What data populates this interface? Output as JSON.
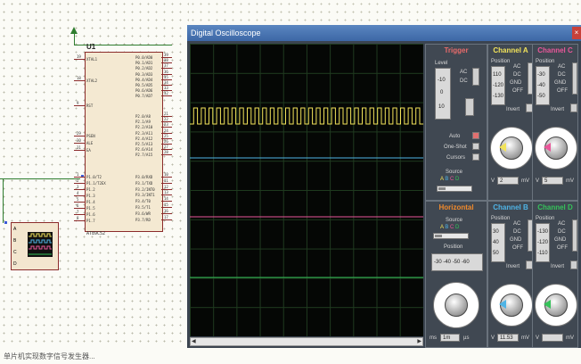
{
  "colors": {
    "channel_a": "#f2e35a",
    "channel_b": "#4fb4e6",
    "channel_c": "#e9579a",
    "channel_d": "#35c25a",
    "trigger": "#e86b6b",
    "horizontal": "#f08a2c"
  },
  "chip": {
    "name": "U1",
    "part": "AT89C52",
    "left_pins": [
      {
        "num": "19",
        "name": "XTAL1"
      },
      {
        "num": "18",
        "name": "XTAL2"
      },
      {
        "num": "9",
        "name": "RST"
      },
      {
        "num": "29",
        "name": "PSEN"
      },
      {
        "num": "30",
        "name": "ALE"
      },
      {
        "num": "31",
        "name": "EA"
      },
      {
        "num": "1",
        "name": "P1.0/T2"
      },
      {
        "num": "2",
        "name": "P1.1/T2EX"
      },
      {
        "num": "3",
        "name": "P1.2"
      },
      {
        "num": "4",
        "name": "P1.3"
      },
      {
        "num": "5",
        "name": "P1.4"
      },
      {
        "num": "6",
        "name": "P1.5"
      },
      {
        "num": "7",
        "name": "P1.6"
      },
      {
        "num": "8",
        "name": "P1.7"
      }
    ],
    "right_pins": [
      {
        "num": "39",
        "name": "P0.0/AD0"
      },
      {
        "num": "38",
        "name": "P0.1/AD1"
      },
      {
        "num": "37",
        "name": "P0.2/AD2"
      },
      {
        "num": "36",
        "name": "P0.3/AD3"
      },
      {
        "num": "35",
        "name": "P0.4/AD4"
      },
      {
        "num": "34",
        "name": "P0.5/AD5"
      },
      {
        "num": "33",
        "name": "P0.6/AD6"
      },
      {
        "num": "32",
        "name": "P0.7/AD7"
      },
      {
        "num": "21",
        "name": "P2.0/A8"
      },
      {
        "num": "22",
        "name": "P2.1/A9"
      },
      {
        "num": "23",
        "name": "P2.2/A10"
      },
      {
        "num": "24",
        "name": "P2.3/A11"
      },
      {
        "num": "25",
        "name": "P2.4/A12"
      },
      {
        "num": "26",
        "name": "P2.5/A13"
      },
      {
        "num": "27",
        "name": "P2.6/A14"
      },
      {
        "num": "28",
        "name": "P2.7/A15"
      },
      {
        "num": "10",
        "name": "P3.0/RXD"
      },
      {
        "num": "11",
        "name": "P3.1/TXD"
      },
      {
        "num": "12",
        "name": "P3.2/INT0"
      },
      {
        "num": "13",
        "name": "P3.3/INT1"
      },
      {
        "num": "14",
        "name": "P3.4/T0"
      },
      {
        "num": "15",
        "name": "P3.5/T1"
      },
      {
        "num": "16",
        "name": "P3.6/WR"
      },
      {
        "num": "17",
        "name": "P3.7/RD"
      }
    ]
  },
  "scope_symbol": {
    "pins": [
      "A",
      "B",
      "C",
      "D"
    ]
  },
  "window": {
    "title": "Digital Oscilloscope",
    "close": "×"
  },
  "trigger": {
    "title": "Trigger",
    "level_label": "Level",
    "level_values": [
      "-10",
      "0",
      "10"
    ],
    "ac": "AC",
    "dc": "DC",
    "auto": "Auto",
    "one_shot": "One-Shot",
    "cursors": "Cursors",
    "source_label": "Source",
    "source_letters": [
      "A",
      "B",
      "C",
      "D"
    ]
  },
  "horizontal": {
    "title": "Horizontal",
    "source_label": "Source",
    "source_letters": [
      "A",
      "B",
      "C",
      "D"
    ],
    "position_label": "Position",
    "position_values": [
      "-30",
      "-40",
      "-50",
      "-60"
    ],
    "dial_value": "1m",
    "unit": "µs",
    "left_unit": "ms"
  },
  "channels": [
    {
      "key": "a",
      "title": "Channel A",
      "position_label": "Position",
      "position_values": [
        "110",
        "-120",
        "-130"
      ],
      "ac": "AC",
      "dc": "DC",
      "gnd": "GND",
      "off": "OFF",
      "invert": "Invert",
      "volt_value": "2",
      "unit_left": "V",
      "unit_right": "mV"
    },
    {
      "key": "c",
      "title": "Channel C",
      "position_label": "Position",
      "position_values": [
        "-30",
        "-40",
        "-50"
      ],
      "ac": "AC",
      "dc": "DC",
      "gnd": "GND",
      "off": "OFF",
      "invert": "Invert",
      "volt_value": "5",
      "unit_left": "V",
      "unit_right": "mV"
    },
    {
      "key": "b",
      "title": "Channel B",
      "position_label": "Position",
      "position_values": [
        "30",
        "40",
        "50"
      ],
      "ac": "AC",
      "dc": "DC",
      "gnd": "GND",
      "off": "OFF",
      "invert": "Invert",
      "volt_value": "11.53",
      "unit_left": "V",
      "unit_right": "mV"
    },
    {
      "key": "d",
      "title": "Channel D",
      "position_label": "Position",
      "position_values": [
        "-130",
        "-120",
        "-110"
      ],
      "ac": "AC",
      "dc": "DC",
      "gnd": "GND",
      "off": "OFF",
      "invert": "Invert",
      "volt_value": "",
      "unit_left": "V",
      "unit_right": "mV"
    }
  ],
  "caption": "单片机实现数字信号发生器..."
}
